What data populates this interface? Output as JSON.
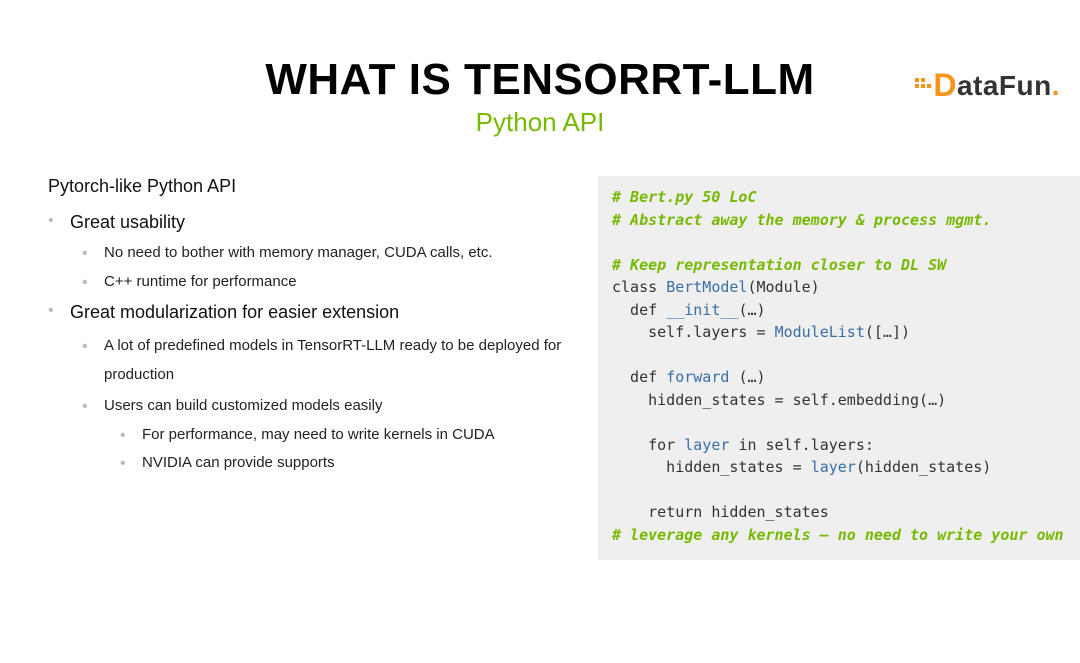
{
  "logo": {
    "text_data": "Data",
    "text_fun": "Fun",
    "period": "."
  },
  "header": {
    "title": "WHAT IS TENSORRT-LLM",
    "subtitle": "Python API"
  },
  "left": {
    "section_head": "Pytorch-like Python API",
    "b1": "Great usability",
    "b1_1": "No need to bother with memory manager, CUDA calls, etc.",
    "b1_2": "C++ runtime for performance",
    "b2": "Great modularization for easier extension",
    "b2_1": "A lot of predefined models in TensorRT-LLM ready to be deployed for production",
    "b2_2": "Users can build customized models easily",
    "b2_2_1": "For performance, may need to write kernels in CUDA",
    "b2_2_2": "NVIDIA can provide supports"
  },
  "code": {
    "c1": "# Bert.py 50 LoC",
    "c2": "# Abstract away the memory & process mgmt.",
    "c3": "# Keep representation closer to DL SW",
    "l1a": "class ",
    "l1b": "BertModel",
    "l1c": "(Module)",
    "l2a": "  def ",
    "l2b": "__init__",
    "l2c": "(…)",
    "l3a": "    self.layers = ",
    "l3b": "ModuleList",
    "l3c": "([…])",
    "l4a": "  def ",
    "l4b": "forward ",
    "l4c": "(…)",
    "l5": "    hidden_states = self.embedding(…)",
    "l6a": "    for ",
    "l6b": "layer ",
    "l6c": "in ",
    "l6d": "self.layers:",
    "l7a": "      hidden_states = ",
    "l7b": "layer",
    "l7c": "(hidden_states)",
    "l8": "    return hidden_states",
    "c4": "# leverage any kernels – no need to write your own"
  }
}
